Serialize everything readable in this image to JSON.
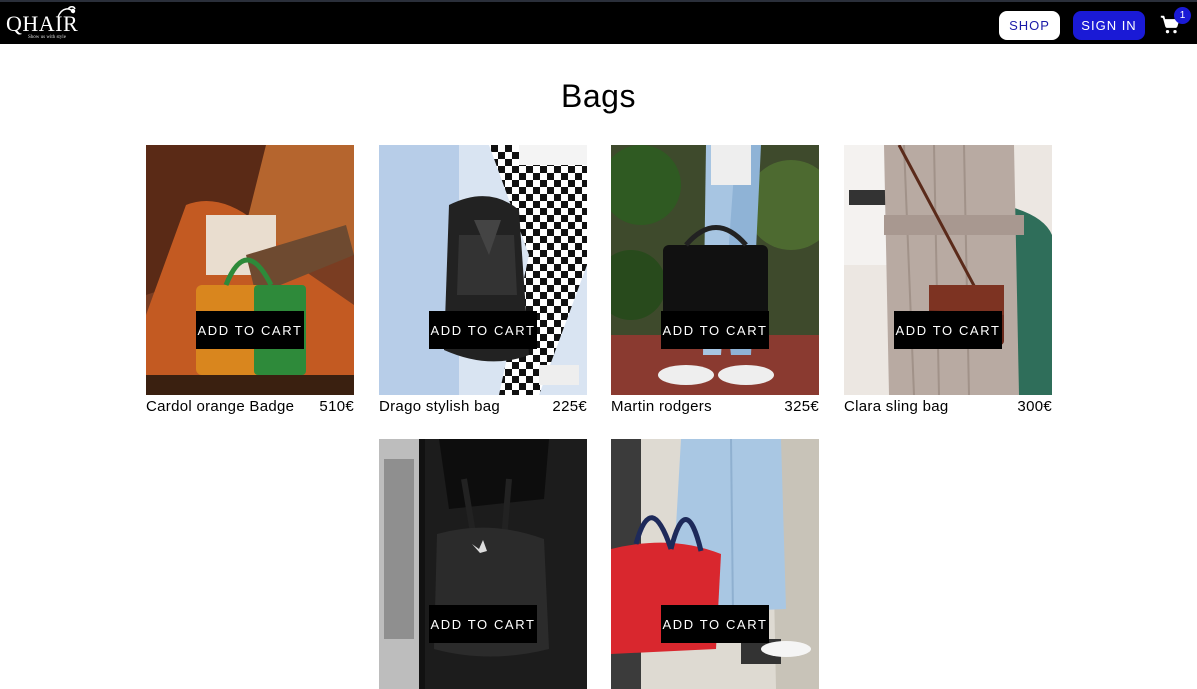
{
  "header": {
    "logo_text": "QHAIR",
    "logo_tagline": "Show us with style",
    "shop_label": "SHOP",
    "signin_label": "SIGN IN",
    "cart_count": "1"
  },
  "page": {
    "title": "Bags"
  },
  "products": [
    {
      "name": "Cardol orange Badge",
      "price": "510€",
      "button": "ADD TO CART"
    },
    {
      "name": "Drago stylish bag",
      "price": "225€",
      "button": "ADD TO CART"
    },
    {
      "name": "Martin rodgers",
      "price": "325€",
      "button": "ADD TO CART"
    },
    {
      "name": "Clara sling bag",
      "price": "300€",
      "button": "ADD TO CART"
    },
    {
      "name": "",
      "price": "",
      "button": "ADD TO CART"
    },
    {
      "name": "",
      "price": "",
      "button": "ADD TO CART"
    }
  ],
  "colors": {
    "navbar_bg": "#000000",
    "primary_blue": "#1a1ad6",
    "button_bg": "#000000"
  }
}
